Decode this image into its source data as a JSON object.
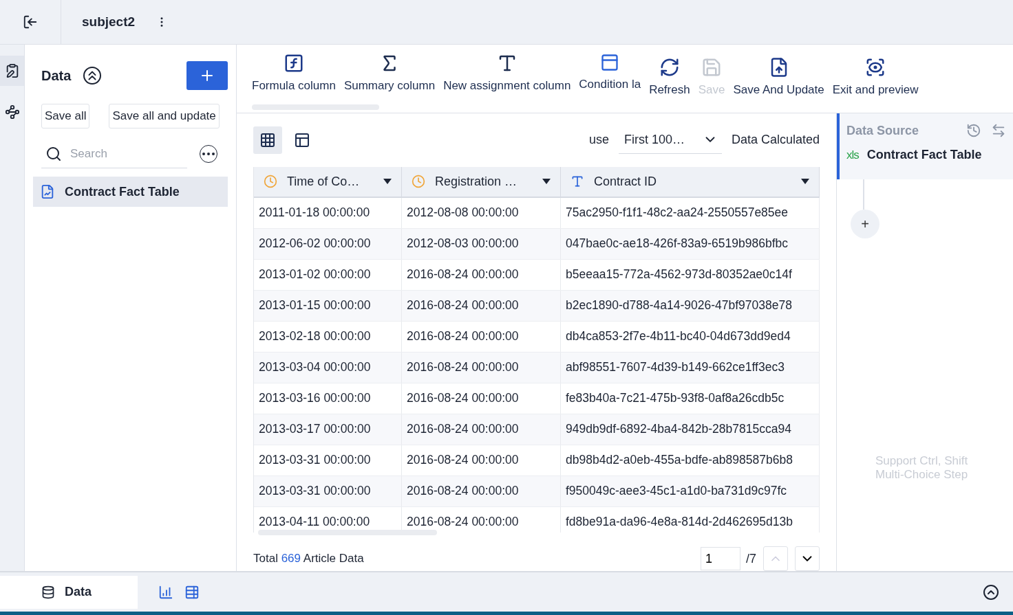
{
  "header": {
    "title": "subject2"
  },
  "sidebar": {
    "title": "Data",
    "buttons": [
      "Save all",
      "Save all and update"
    ],
    "search": {
      "placeholder": "Search"
    },
    "items": [
      {
        "label": "Contract Fact Table",
        "selected": true
      }
    ]
  },
  "toolbar": [
    {
      "kind": "formula",
      "label": "Formula column",
      "disabled": false
    },
    {
      "kind": "sum",
      "label": "Summary column",
      "disabled": false
    },
    {
      "kind": "assign",
      "label": "New assignment column",
      "disabled": false
    },
    {
      "kind": "condition",
      "label": "Condition la",
      "disabled": false
    },
    {
      "kind": "refresh",
      "label": "Refresh",
      "disabled": false
    },
    {
      "kind": "save",
      "label": "Save",
      "disabled": true
    },
    {
      "kind": "update",
      "label": "Save And Update",
      "disabled": false
    },
    {
      "kind": "preview",
      "label": "Exit and preview",
      "disabled": false
    }
  ],
  "views": [
    {
      "kind": "grid",
      "selected": true
    },
    {
      "kind": "layout",
      "selected": false
    }
  ],
  "use_label": "use",
  "use_value": "First 100…",
  "calc_label": "Data Calculated",
  "table": {
    "columns": [
      {
        "kind": "time",
        "label": "Time of Co…"
      },
      {
        "kind": "time",
        "label": "Registration …"
      },
      {
        "kind": "text",
        "label": "Contract ID"
      }
    ],
    "rows": [
      [
        "2011-01-18 00:00:00",
        "2012-08-08 00:00:00",
        "75ac2950-f1f1-48c2-aa24-2550557e85ee"
      ],
      [
        "2012-06-02 00:00:00",
        "2012-08-03 00:00:00",
        "047bae0c-ae18-426f-83a9-6519b986bfbc"
      ],
      [
        "2013-01-02 00:00:00",
        "2016-08-24 00:00:00",
        "b5eeaa15-772a-4562-973d-80352ae0c14f"
      ],
      [
        "2013-01-15 00:00:00",
        "2016-08-24 00:00:00",
        "b2ec1890-d788-4a14-9026-47bf97038e78"
      ],
      [
        "2013-02-18 00:00:00",
        "2016-08-24 00:00:00",
        "db4ca853-2f7e-4b11-bc40-04d673dd9ed4"
      ],
      [
        "2013-03-04 00:00:00",
        "2016-08-24 00:00:00",
        "abf98551-7607-4d39-b149-662ce1ff3ec3"
      ],
      [
        "2013-03-16 00:00:00",
        "2016-08-24 00:00:00",
        "fe83b40a-7c21-475b-93f8-0af8a26cdb5c"
      ],
      [
        "2013-03-17 00:00:00",
        "2016-08-24 00:00:00",
        "949db9df-6892-4ba4-842b-28b7815cca94"
      ],
      [
        "2013-03-31 00:00:00",
        "2016-08-24 00:00:00",
        "db98b4d2-a0eb-455a-bdfe-ab898587b6b8"
      ],
      [
        "2013-03-31 00:00:00",
        "2016-08-24 00:00:00",
        "f950049c-aee3-45c1-a1d0-ba731d9c97fc"
      ],
      [
        "2013-04-11 00:00:00",
        "2016-08-24 00:00:00",
        "fd8be91a-da96-4e8a-814d-2d462695d13b"
      ]
    ]
  },
  "footer": {
    "total_prefix": "Total",
    "total_count": "669",
    "total_suffix": "Article Data",
    "page": "1",
    "pages": "/7"
  },
  "right_panel": {
    "title": "Data Source",
    "source": "Contract Fact Table",
    "source_badge": "xls",
    "add": "+",
    "hint": [
      "Support Ctrl, Shift",
      "Multi-Choice Step"
    ]
  },
  "bottom_tabs": [
    {
      "kind": "data",
      "label": "Data",
      "selected": true
    },
    {
      "kind": "chart",
      "selected": false
    },
    {
      "kind": "table",
      "selected": false
    }
  ]
}
